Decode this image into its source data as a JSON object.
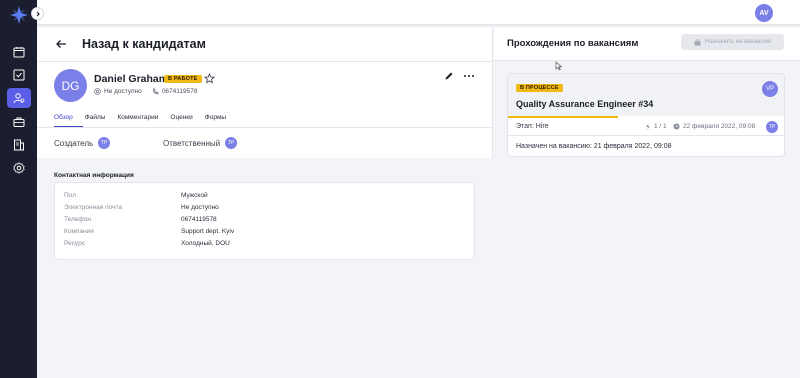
{
  "sidebar": {
    "logo": "logo-icon",
    "collapse_icon": "chevron-right-icon",
    "items": [
      {
        "icon": "calendar-icon",
        "active": false
      },
      {
        "icon": "checkbox-icon",
        "active": false
      },
      {
        "icon": "candidates-icon",
        "active": true
      },
      {
        "icon": "briefcase-icon",
        "active": false
      },
      {
        "icon": "reports-icon",
        "active": false
      },
      {
        "icon": "settings-icon",
        "active": false
      }
    ]
  },
  "topbar": {
    "user_initials": "AV"
  },
  "header": {
    "back_label": "Назад к кандидатам"
  },
  "profile": {
    "initials": "DG",
    "name": "Daniel Graham",
    "status": "В РАБОТЕ",
    "email": "Не доступно",
    "phone": "0674119578"
  },
  "tabs": [
    {
      "label": "Обзор",
      "active": true
    },
    {
      "label": "Файлы",
      "active": false
    },
    {
      "label": "Комментарии",
      "active": false
    },
    {
      "label": "Оценки",
      "active": false
    },
    {
      "label": "Формы",
      "active": false
    }
  ],
  "roles": {
    "creator_label": "Создатель",
    "creator_initials": "TP",
    "responsible_label": "Ответственный",
    "responsible_initials": "TP"
  },
  "contact": {
    "title": "Контактная информация",
    "rows": [
      {
        "label": "Пол",
        "value": "Мужской"
      },
      {
        "label": "Электронная почта",
        "value": "Не доступно"
      },
      {
        "label": "Телефон",
        "value": "0674119578"
      },
      {
        "label": "Компания",
        "value": "Support dept. Kyiv"
      },
      {
        "label": "Ресурс",
        "value": "Холодный,  DOU"
      }
    ]
  },
  "right": {
    "title": "Прохождения по вакансиям",
    "assign_button": "Назначить на вакансию"
  },
  "vacancy": {
    "status": "В ПРОЦЕССЕ",
    "title": "Quality Assurance Engineer #34",
    "avatar": "VP",
    "progress": 0.4,
    "stage": "Этап: Hire",
    "count": "1 / 1",
    "date": "22 февраля 2022, 09:08",
    "mini_initials": "TP",
    "assigned": "Назначен на вакансию: 21 февраля 2022, 09:08"
  },
  "colors": {
    "accent": "#5b5ee6",
    "badge": "#f2b814",
    "avatar": "#7b7fe8",
    "sidebar": "#1b1e2e"
  }
}
